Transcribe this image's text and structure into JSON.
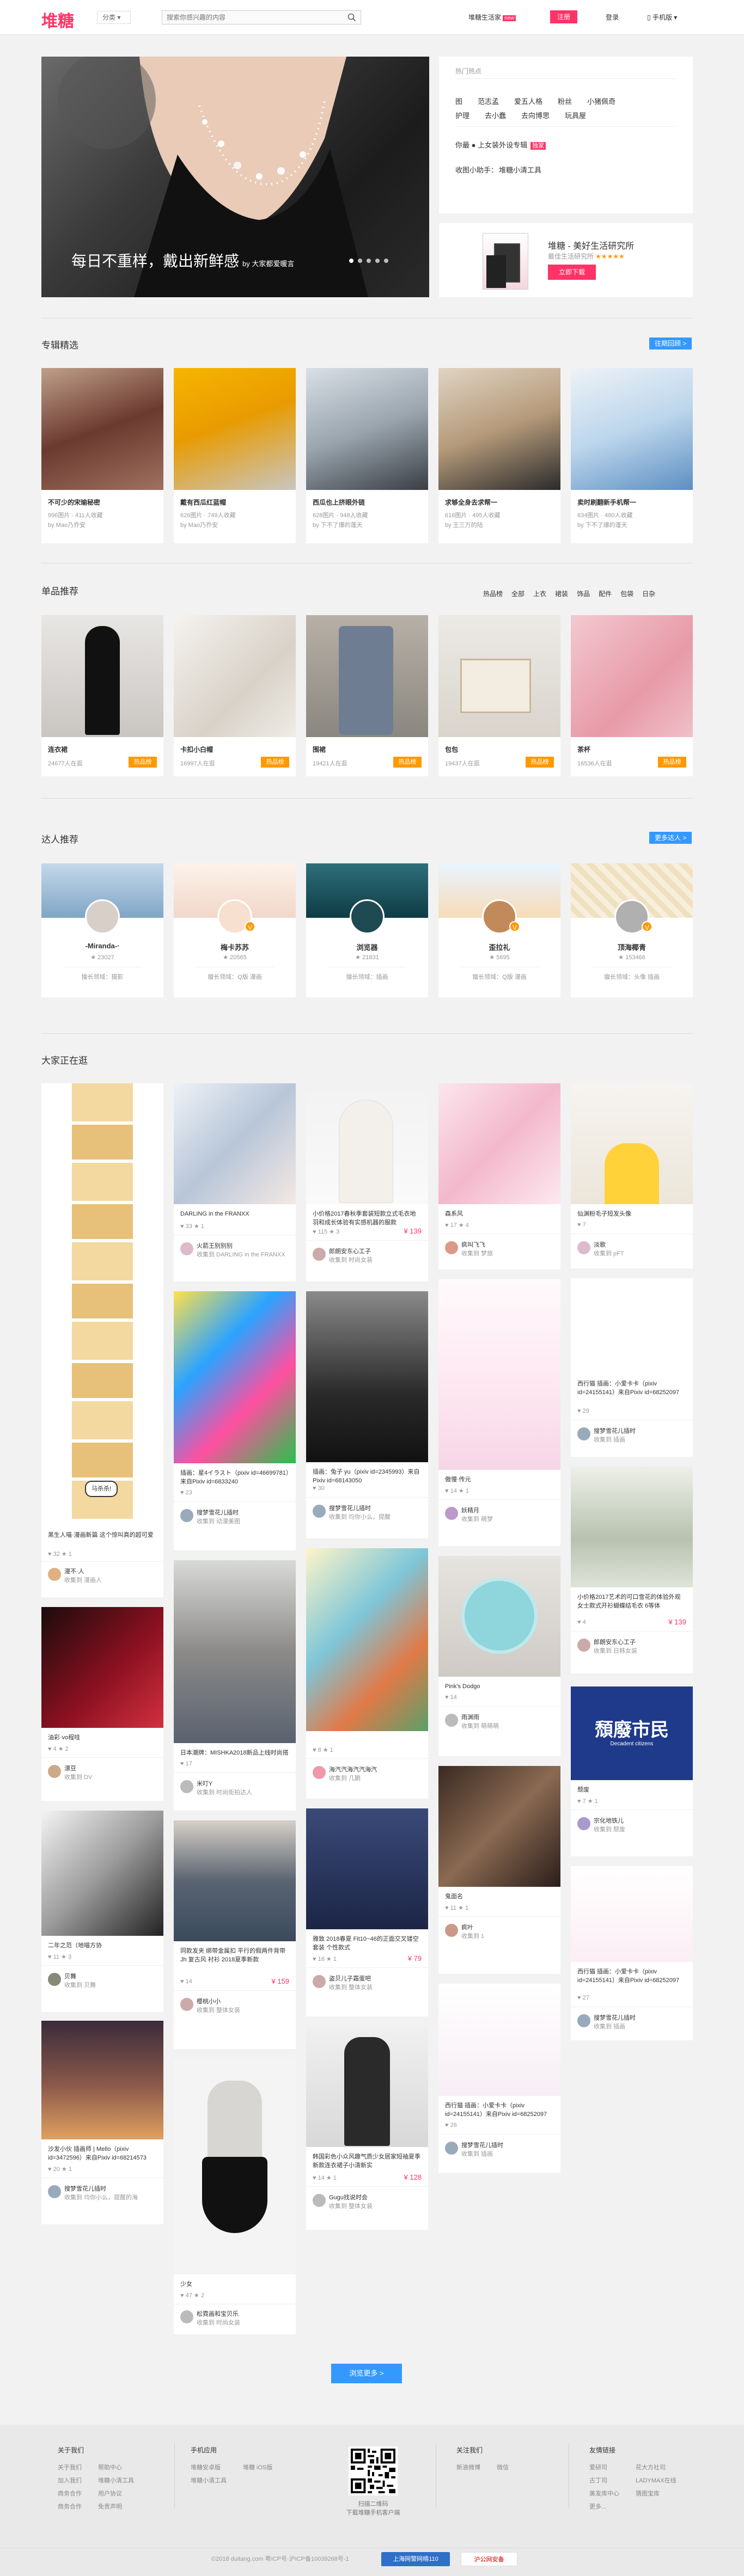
{
  "header": {
    "logo": "堆糖",
    "category": "分类",
    "search_placeholder": "搜索你感兴趣的内容",
    "links": [
      "堆糖生活家",
      "注册",
      "登录",
      "手机版"
    ],
    "new_badge": "new"
  },
  "banner": {
    "caption": "每日不重样，戴出新鲜感",
    "author": "by 大家都爱暖言"
  },
  "hot": {
    "title": "热门热点",
    "row1": [
      "图",
      "范志孟",
      "爱五人格",
      "粉丝",
      "小猪佩奇"
    ],
    "row2": [
      "护理",
      "去小蠢",
      "去向博思",
      "玩具屋"
    ],
    "promo": "你最 ● 上女装外设专辑",
    "promo_tag": "独家",
    "contact": "收图小助手：",
    "contact_val": "堆糖小清工具"
  },
  "app_promo": {
    "title": "堆糖 - 美好生活研究所",
    "sub": "最佳生活研究所",
    "stars": "★★★★★",
    "download": "立即下载"
  },
  "sections": {
    "album_title": "专辑精选",
    "album_more": "往期回顾 >",
    "goods_title": "单品推荐",
    "goods_filters": [
      "热品榜",
      "全部",
      "上衣",
      "裙装",
      "饰品",
      "配件",
      "包袋",
      "日杂"
    ],
    "talent_title": "达人推荐",
    "talent_more": "更多达人 >",
    "feed_title": "大家正在逛"
  },
  "albums": [
    {
      "title": "不可少的宋瑜秘密",
      "meta": "996图片 · 411人收藏",
      "by": "by Mao乃乔安"
    },
    {
      "title": "戴有西瓜红蓝帽",
      "meta": "626图片 · 749人收藏",
      "by": "by Mao乃乔安"
    },
    {
      "title": "西瓜也上挤眼外链",
      "meta": "628图片 · 948人收藏",
      "by": "by 下不了爆的蓬天"
    },
    {
      "title": "求够全身去求帮一",
      "meta": "618图片 · 495人收藏",
      "by": "by 王三万的陆"
    },
    {
      "title": "卖时刷翻新手机帮一",
      "meta": "634图片 · 480人收藏",
      "by": "by 下不了爆的蓬天"
    }
  ],
  "goods": [
    {
      "name": "连衣裙",
      "count": "24677人在逛",
      "tag": "热品榜"
    },
    {
      "name": "卡扣小白帽",
      "count": "16997人在逛",
      "tag": "热品榜"
    },
    {
      "name": "围裙",
      "count": "19421人在逛",
      "tag": "热品榜"
    },
    {
      "name": "包包",
      "count": "19437人在逛",
      "tag": "热品榜"
    },
    {
      "name": "茶杯",
      "count": "16536人在逛",
      "tag": "热品榜"
    }
  ],
  "talents": [
    {
      "name": "-Miranda-·",
      "fans": "★ 23027",
      "desc": "擅长领域：摄影"
    },
    {
      "name": "梅卡苏苏",
      "fans": "★ 20565",
      "desc": "擅长领域：Q版 漫画"
    },
    {
      "name": "浏览器",
      "fans": "★ 21831",
      "desc": "擅长领域：插画"
    },
    {
      "name": "歪拉礼",
      "fans": "★ 5695",
      "desc": "擅长领域：Q版 漫画"
    },
    {
      "name": "顶海椰青",
      "fans": "★ 153466",
      "desc": "擅长领域：头像 插画"
    }
  ],
  "feed": [
    {
      "title": "黑生人喵·漫画新篇 这个惊叫真的超可爱",
      "stats": "♥ 32  ★ 1",
      "user": "漫不·人",
      "board": "收集到 漫画人"
    },
    {
      "title": "油彩·vo程哇",
      "stats": "♥ 4  ★ 2",
      "user": "漂豆",
      "board": "收集到 DV"
    },
    {
      "title": "二年之范（地喵方协",
      "stats": "♥ 11  ★ 3",
      "user": "贝舞",
      "board": "收集到 贝舞"
    },
    {
      "title": "沙发小伙 插画师 | Mello（pixiv id=3472596）来自Pixiv id=68214573",
      "stats": "♥ 20  ★ 1",
      "user": "搜梦雪花儿插时",
      "board": "收集到 均你小么，提醒的海"
    },
    {
      "title": "DARLING in the FRANXX",
      "stats": "♥ 33  ★ 1",
      "user": "火箭王别别别",
      "board": "收集到 DARLING in the FRANXX"
    },
    {
      "title": "插画：星4イラスト（pixiv id=46699781）来自Pixiv id=6833240",
      "stats": "♥ 23",
      "user": "搜梦雪花儿插时",
      "board": "收集到 动漫美图"
    },
    {
      "title": "日本潮牌：MISHKA2018新品上线时尚搭",
      "stats": "♥ 17",
      "user": "米叮Y",
      "board": "收集到 时尚街拍达人"
    },
    {
      "title": "同款发夹 绑带金属扣 平行的假两件背带 Jh 复古风 衬衫 2018夏季新款",
      "stats": "♥ 14",
      "price": "¥ 159",
      "user": "樱桃小小",
      "board": "收集到 整体女装"
    },
    {
      "title": "少女",
      "stats": "♥ 47  ★ 2",
      "user": "松霓画和宝贝乐",
      "board": "收集到 时尚女装"
    },
    {
      "title": "小价格2017春秋季套装短款立式毛衣地羽和成长体验有实感机器的服款",
      "stats": "♥ 115  ★ 3",
      "price": "¥ 139",
      "user": "郎朗安东心工子",
      "board": "收集到 时尚女装"
    },
    {
      "title": "插画：兔子 yu（pixiv id=2345993）来自Pixiv id=68143050",
      "stats": "♥ 30",
      "user": "搜梦雪花儿插时",
      "board": "收集到 均你小么，提醒"
    },
    {
      "title": "",
      "stats": "♥ 8  ★ 1",
      "user": "海汽汽海汽汽海汽",
      "board": "收集到 几鹏"
    },
    {
      "title": "雅致 2018春夏 Fit10~46的正面交叉镂空套装 个性款式",
      "stats": "♥ 16  ★ 1",
      "price": "¥ 79",
      "user": "盗贝儿子霜蛋吧",
      "board": "收集到 整体女装"
    },
    {
      "title": "韩国彩色小众风趣气质少女居家短袖夏季新款连衣裙子小清新实",
      "stats": "♥ 14  ★ 1",
      "price": "¥ 128",
      "user": "Gugu找说时会",
      "board": "收集到 整体女装"
    },
    {
      "title": "森系风",
      "stats": "♥ 17  ★ 4",
      "user": "疯叫飞飞",
      "board": "收集到 梦旅"
    },
    {
      "title": "傲慢·传元",
      "stats": "♥ 14  ★ 1",
      "user": "妖精月",
      "board": "收集到 萌梦"
    },
    {
      "title": "Pink's Dodgo",
      "stats": "♥ 14",
      "user": "雨渊雨",
      "board": "收集到 萌萌萌"
    },
    {
      "title": "鬼面名",
      "stats": "♥ 11  ★ 1",
      "user": "疯叶",
      "board": "收集到 1"
    },
    {
      "title": "西行猫 插画：小爱卡卡（pixiv id=24155141）来自Pixiv id=68252097",
      "stats": "♥ 26",
      "user": "搜梦雪花儿插时",
      "board": "收集到 插画"
    },
    {
      "title": "仙渊粉毛子短发头像",
      "stats": "♥ 7",
      "user": "淡歌",
      "board": "收集到 pFT"
    },
    {
      "title": "西行猫 插画：小爱卡卡（pixiv id=24155141）来自Pixiv id=68252097",
      "stats": "♥ 29",
      "user": "搜梦雪花儿插时",
      "board": "收集到 插画"
    },
    {
      "title": "小价格2017艺术的可口雪花的体验外观女士款式开衫蝴蝶结毛衣 6等体",
      "stats": "♥ 4",
      "price": "¥ 139",
      "user": "郎朗安东心工子",
      "board": "收集到 日韩女装"
    },
    {
      "title": "颓废",
      "stats": "♥ 7  ★ 1",
      "user": "宗化地铁儿",
      "board": "收集到 颓废"
    },
    {
      "title": "西行猫 插画：小爱卡卡（pixiv id=24155141）来自Pixiv id=68252097",
      "stats": "♥ 27",
      "user": "搜梦雪花儿插时",
      "board": "收集到 插画"
    }
  ],
  "feed_text": {
    "poster_cn": "頹廢市民",
    "poster_en": "Decadent citizens",
    "speech": "马杀杀!"
  },
  "loadmore": "浏览更多 >",
  "footer": {
    "about": {
      "title": "关于我们",
      "items": [
        "关于我们",
        "帮助中心",
        "加入我们",
        "堆糖小清工具",
        "商务合作",
        "用户协议",
        "商务合作",
        "免责声明"
      ]
    },
    "mobile": {
      "title": "手机应用",
      "items": [
        "堆糖安卓版",
        "堆糖 iOS版",
        "堆糖小清工具"
      ]
    },
    "qr_caption": "扫描二维码\n下载堆糖手机客户端",
    "follow": {
      "title": "关注我们",
      "items": [
        "新浪微博",
        "微信"
      ]
    },
    "friends": {
      "title": "友情链接",
      "items": [
        "爱研司",
        "花大方社司",
        "古丁司",
        "LADYMAX在线",
        "美发库中心",
        "猜图宝库",
        "更多..."
      ]
    },
    "copyright": "©2018 duitang.com  粤ICP号·沪ICP备10039268号-1",
    "badge1": "上海网警网络110",
    "badge2": "沪公网安备"
  }
}
